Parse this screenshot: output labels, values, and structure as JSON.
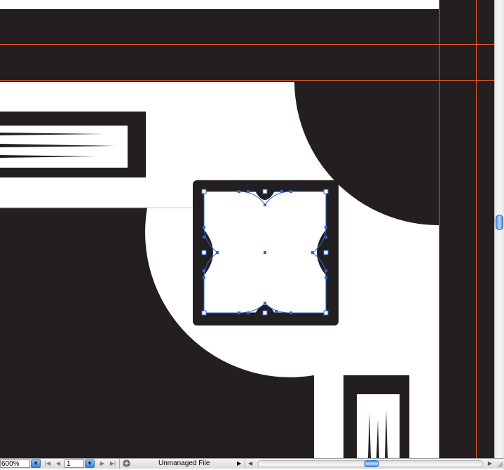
{
  "status_bar": {
    "zoom_value": "600%",
    "page_value": "1",
    "file_status": "Unmanaged File"
  },
  "icons": {
    "zoom_dropdown": "chevron-down-icon",
    "first_page": "first-page-icon",
    "previous_page": "previous-page-icon",
    "next_page": "next-page-icon",
    "last_page": "last-page-icon",
    "page_dropdown": "chevron-down-icon",
    "file_status": "file-status-icon",
    "status_menu": "triangle-right-icon",
    "scroll_left": "scroll-left-icon",
    "scroll_right": "scroll-right-icon",
    "resize_grip": "resize-grip-icon"
  },
  "colors": {
    "artwork_dark": "#231f20",
    "artwork_light": "#ffffff",
    "guide": "#e8582a",
    "selection": "#2e65d9",
    "scroll_thumb": "#4f8fd8"
  }
}
